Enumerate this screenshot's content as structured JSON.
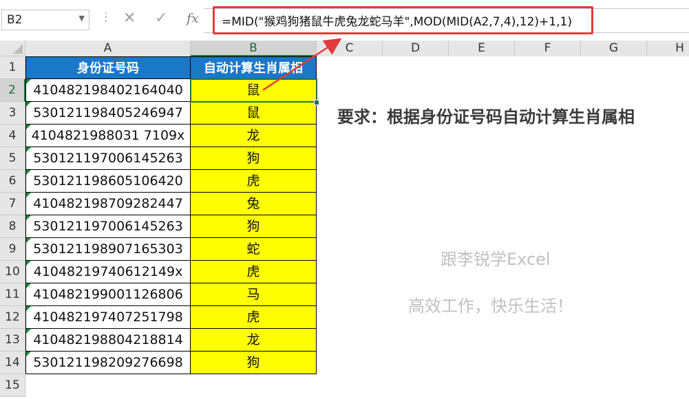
{
  "formula_bar": {
    "name_box": "B2",
    "formula": "=MID(\"猴鸡狗猪鼠牛虎兔龙蛇马羊\",MOD(MID(A2,7,4),12)+1,1)",
    "fx_label": "fx"
  },
  "columns": [
    "A",
    "B",
    "C",
    "D",
    "E",
    "F",
    "G",
    "H"
  ],
  "rows": [
    "1",
    "2",
    "3",
    "4",
    "5",
    "6",
    "7",
    "8",
    "9",
    "10",
    "11",
    "12",
    "13",
    "14",
    "15"
  ],
  "table": {
    "headers": [
      "身份证号码",
      "自动计算生肖属相"
    ],
    "rows": [
      [
        "410482198402164040",
        "鼠"
      ],
      [
        "530121198405246947",
        "鼠"
      ],
      [
        "4104821988031 7109x",
        "龙"
      ],
      [
        "530121197006145263",
        "狗"
      ],
      [
        "530121198605106420",
        "虎"
      ],
      [
        "410482198709282447",
        "兔"
      ],
      [
        "530121197006145263",
        "狗"
      ],
      [
        "530121198907165303",
        "蛇"
      ],
      [
        "41048219740612149x",
        "虎"
      ],
      [
        "410482199001126806",
        "马"
      ],
      [
        "410482197407251798",
        "虎"
      ],
      [
        "410482198804218814",
        "龙"
      ],
      [
        "530121198209276698",
        "狗"
      ]
    ]
  },
  "annotation": {
    "requirement": "要求：根据身份证号码自动计算生肖属相",
    "watermark_line1": "跟李锐学Excel",
    "watermark_line2": "高效工作，快乐生活！"
  },
  "colors": {
    "header_fill": "#1a78c9",
    "result_fill": "#ffff00",
    "highlight_border": "#e23b3b",
    "selection_border": "#217346"
  }
}
